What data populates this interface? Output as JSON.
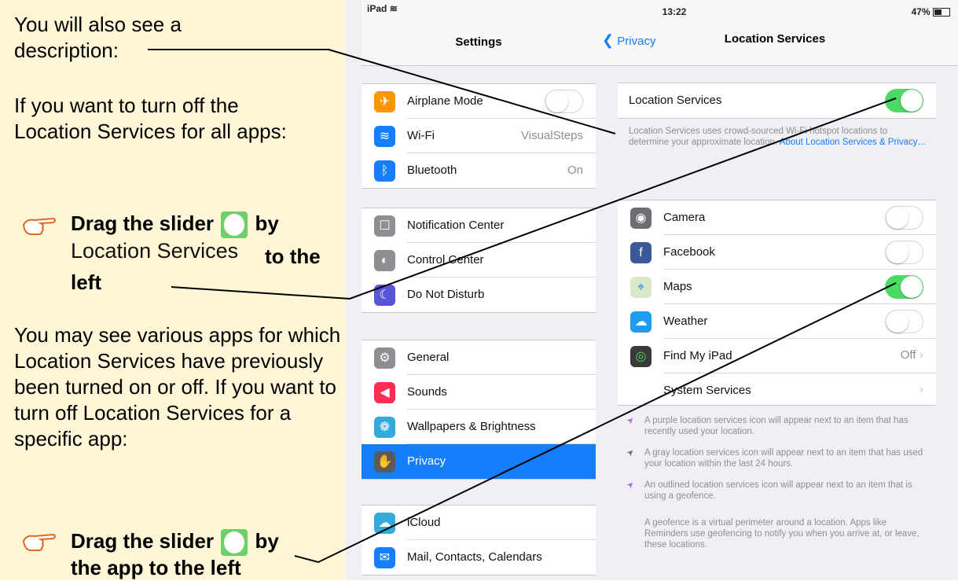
{
  "instructions": {
    "para1": "You will also see a description:",
    "para2": "If you want to turn off the Location Services for all apps:",
    "step1_a": "Drag the slider",
    "step1_b": "by",
    "step1_label": "Location Services",
    "step1_c": "to the left",
    "para3": "You may see various apps for which Location Services have previously been turned on or off. If you want to turn off Location Services for a specific app:",
    "step2_a": "Drag the slider",
    "step2_b": "by",
    "step2_c": "the app to the left"
  },
  "status": {
    "device": "iPad",
    "time": "13:22",
    "battery": "47%"
  },
  "settings": {
    "title": "Settings",
    "groups": [
      [
        {
          "label": "Airplane Mode",
          "icon": "airplane-icon",
          "color": "#ff9500",
          "toggle": "off"
        },
        {
          "label": "Wi-Fi",
          "icon": "wifi-icon",
          "color": "#157efb",
          "value": "VisualSteps"
        },
        {
          "label": "Bluetooth",
          "icon": "bluetooth-icon",
          "color": "#157efb",
          "value": "On"
        }
      ],
      [
        {
          "label": "Notification Center",
          "icon": "notification-center-icon",
          "color": "#8e8e93"
        },
        {
          "label": "Control Center",
          "icon": "control-center-icon",
          "color": "#8e8e93"
        },
        {
          "label": "Do Not Disturb",
          "icon": "moon-icon",
          "color": "#5856d6"
        }
      ],
      [
        {
          "label": "General",
          "icon": "gear-icon",
          "color": "#8e8e93"
        },
        {
          "label": "Sounds",
          "icon": "speaker-icon",
          "color": "#ff2d55"
        },
        {
          "label": "Wallpapers & Brightness",
          "icon": "flower-icon",
          "color": "#34aadc"
        },
        {
          "label": "Privacy",
          "icon": "hand-icon",
          "color": "#5a5a5e",
          "selected": true
        }
      ],
      [
        {
          "label": "iCloud",
          "icon": "cloud-icon",
          "color": "#34aadc"
        },
        {
          "label": "Mail, Contacts, Calendars",
          "icon": "mail-icon",
          "color": "#157efb"
        }
      ]
    ]
  },
  "location": {
    "back": "Privacy",
    "title": "Location Services",
    "main_label": "Location Services",
    "main_toggle": "on",
    "desc": "Location Services uses crowd-sourced Wi-Fi hotspot locations to determine your approximate location.",
    "desc_link": "About Location Services & Privacy…",
    "apps": [
      {
        "label": "Camera",
        "toggle": "off",
        "icon": "camera-icon"
      },
      {
        "label": "Facebook",
        "toggle": "off",
        "icon": "facebook-icon"
      },
      {
        "label": "Maps",
        "toggle": "on",
        "icon": "maps-icon"
      },
      {
        "label": "Weather",
        "toggle": "off",
        "icon": "weather-icon"
      },
      {
        "label": "Find My iPad",
        "value": "Off",
        "icon": "find-my-ipad-icon"
      },
      {
        "label": "System Services"
      }
    ],
    "notes": [
      "A purple location services icon will appear next to an item that has recently used your location.",
      "A gray location services icon will appear next to an item that has used your location within the last 24 hours.",
      "An outlined location services icon will appear next to an item that is using a geofence."
    ],
    "geofence": "A geofence is a virtual perimeter around a location. Apps like Reminders use geofencing to notify you when you arrive at, or leave, these locations."
  },
  "colors": {
    "toggle_on": "#4cd964",
    "ios_blue": "#157efb",
    "instruction_bg": "#fff6d8",
    "purple_arrow": "#b36ae2"
  }
}
